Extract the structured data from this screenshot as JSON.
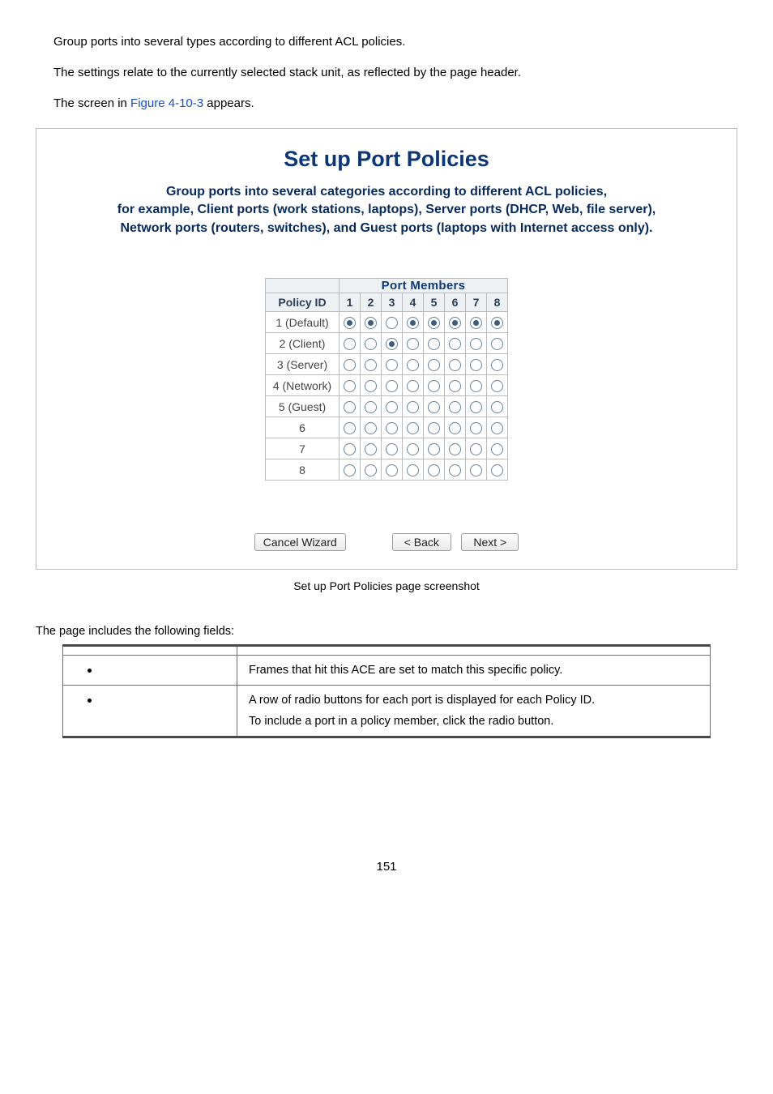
{
  "intro": {
    "p1": "Group ports into several types according to different ACL policies.",
    "p2": "The settings relate to the currently selected stack unit, as reflected by the page header.",
    "p3_prefix": "The screen in ",
    "p3_link": "Figure 4-10-3",
    "p3_suffix": " appears."
  },
  "panel": {
    "title": "Set up Port Policies",
    "desc_line1": "Group ports into several categories according to different ACL policies,",
    "desc_line2": "for example, Client ports (work stations, laptops), Server ports (DHCP, Web, file server),",
    "desc_line3": "Network ports (routers, switches), and Guest ports (laptops with Internet access only).",
    "port_members_header": "Port Members",
    "policy_id_header": "Policy ID",
    "columns": [
      "1",
      "2",
      "3",
      "4",
      "5",
      "6",
      "7",
      "8"
    ],
    "rows": [
      {
        "label": "1 (Default)",
        "selected": [
          1,
          1,
          0,
          1,
          1,
          1,
          1,
          1
        ]
      },
      {
        "label": "2 (Client)",
        "selected": [
          0,
          0,
          1,
          0,
          0,
          0,
          0,
          0
        ]
      },
      {
        "label": "3 (Server)",
        "selected": [
          0,
          0,
          0,
          0,
          0,
          0,
          0,
          0
        ]
      },
      {
        "label": "4 (Network)",
        "selected": [
          0,
          0,
          0,
          0,
          0,
          0,
          0,
          0
        ]
      },
      {
        "label": "5 (Guest)",
        "selected": [
          0,
          0,
          0,
          0,
          0,
          0,
          0,
          0
        ]
      },
      {
        "label": "6",
        "selected": [
          0,
          0,
          0,
          0,
          0,
          0,
          0,
          0
        ]
      },
      {
        "label": "7",
        "selected": [
          0,
          0,
          0,
          0,
          0,
          0,
          0,
          0
        ]
      },
      {
        "label": "8",
        "selected": [
          0,
          0,
          0,
          0,
          0,
          0,
          0,
          0
        ]
      }
    ],
    "buttons": {
      "cancel": "Cancel Wizard",
      "back": "< Back",
      "next": "Next >"
    }
  },
  "caption": "Set up Port Policies page screenshot",
  "fields_intro": "The page includes the following fields:",
  "fields": [
    {
      "desc_lines": [
        "Frames that hit this ACE are set to match this specific policy."
      ]
    },
    {
      "desc_lines": [
        "A row of radio buttons for each port is displayed for each Policy ID.",
        "To include a port in a policy member, click the radio button."
      ]
    }
  ],
  "page_number": "151"
}
